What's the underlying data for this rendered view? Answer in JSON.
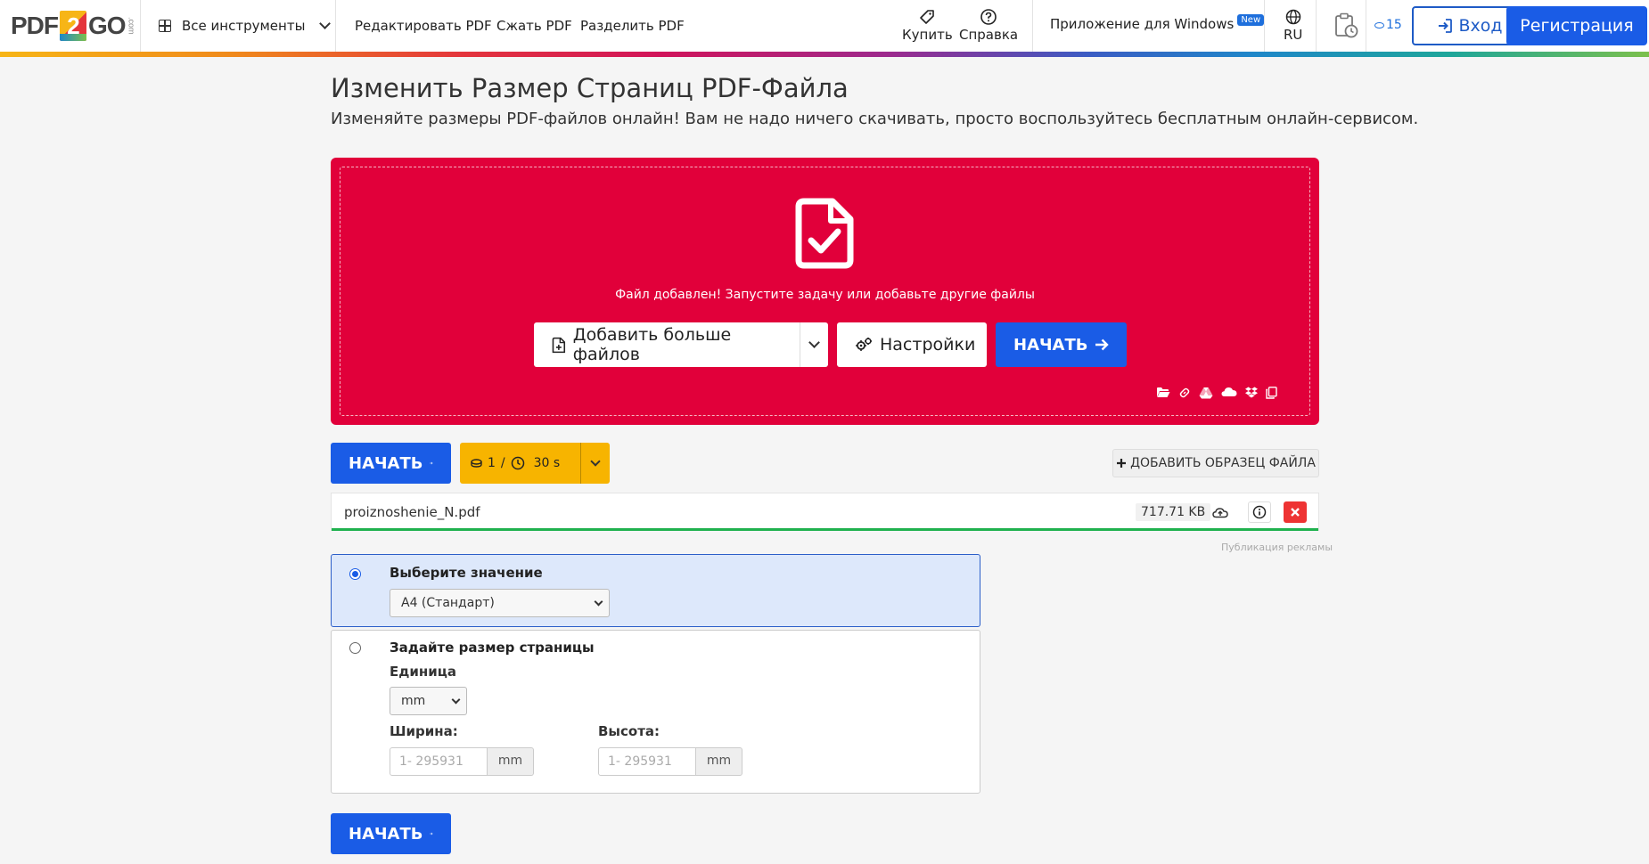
{
  "header": {
    "logo_left": "PDF",
    "logo_mid": "2",
    "logo_right": "GO",
    "logo_suffix": ".com",
    "all_tools": "Все инструменты",
    "nav": [
      "Редактировать PDF",
      "Сжать PDF",
      "Разделить PDF"
    ],
    "buy": "Купить",
    "help": "Справка",
    "windows_app": "Приложение для Windows",
    "new_badge": "New",
    "lang": "RU",
    "credits": "15",
    "login": "Вход",
    "register": "Регистрация"
  },
  "main": {
    "title": "Изменить Размер Страниц PDF-Файла",
    "subtitle": "Изменяйте размеры PDF-файлов онлайн! Вам не надо ничего скачивать, просто воспользуйтесь бесплатным онлайн-сервисом.",
    "dropzone": {
      "message": "Файл добавлен! Запустите задачу или добавьте другие файлы",
      "add_more": "Добавить больше файлов",
      "settings": "Настройки",
      "start": "НАЧАТЬ"
    },
    "start": "НАЧАТЬ",
    "credit_cost": "1",
    "credit_sep": "/",
    "time": "30 s",
    "add_sample": "ДОБАВИТЬ ОБРАЗЕЦ ФАЙЛА",
    "file": {
      "name": "proiznoshenie_N.pdf",
      "size": "717.71 KB",
      "progress": 1.0
    },
    "ad_note": "Публикация рекламы",
    "option_preset": {
      "label": "Выберите значение",
      "selected": "A4 (Стандарт)"
    },
    "option_custom": {
      "label": "Задайте размер страницы",
      "unit_label": "Единица",
      "unit_selected": "mm",
      "width_label": "Ширина:",
      "height_label": "Высота:",
      "width_placeholder": "1- 295931",
      "height_placeholder": "1- 295931",
      "unit_addon": "mm"
    },
    "bottom_start": "НАЧАТЬ"
  },
  "colors": {
    "accent": "#1a5ce6",
    "dropzone": "#e1003a",
    "credit": "#f7b400",
    "progress": "#1fb14e"
  }
}
